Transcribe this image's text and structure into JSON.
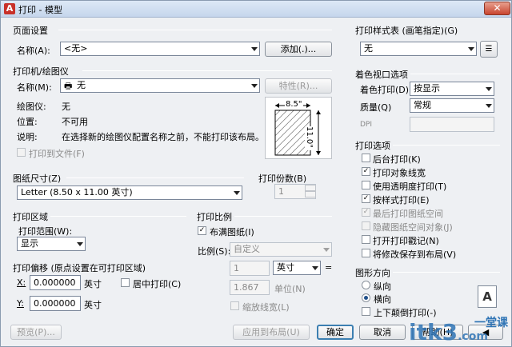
{
  "window": {
    "title": "打印 - 模型",
    "app_icon": "A",
    "close": "✕"
  },
  "page_setup": {
    "group": "页面设置",
    "name_label": "名称(A):",
    "name_value": "<无>",
    "add_button": "添加(.)..."
  },
  "printer": {
    "group": "打印机/绘图仪",
    "name_label": "名称(M):",
    "name_value": "无",
    "properties_button": "特性(R)...",
    "plotter_label": "绘图仪:",
    "plotter_value": "无",
    "location_label": "位置:",
    "location_value": "不可用",
    "description_label": "说明:",
    "description_value": "在选择新的绘图仪配置名称之前，不能打印该布局。",
    "print_to_file": "打印到文件(F)"
  },
  "paper_preview": {
    "width": "8.5\"",
    "height": "11.0\""
  },
  "paper_size": {
    "group": "图纸尺寸(Z)",
    "value": "Letter (8.50 x 11.00 英寸)"
  },
  "copies": {
    "label": "打印份数(B)",
    "value": "1"
  },
  "plot_area": {
    "group": "打印区域",
    "range_label": "打印范围(W):",
    "range_value": "显示"
  },
  "plot_scale": {
    "group": "打印比例",
    "fit_paper": "布满图纸(I)",
    "scale_label": "比例(S):",
    "scale_value": "自定义",
    "value1": "1",
    "unit_value": "英寸",
    "eq": "=",
    "value2": "1.867",
    "unit_label": "单位(N)",
    "scale_lineweights": "缩放线宽(L)"
  },
  "plot_offset": {
    "group": "打印偏移 (原点设置在可打印区域)",
    "x_label": "X:",
    "x_value": "0.000000",
    "x_unit": "英寸",
    "y_label": "Y:",
    "y_value": "0.000000",
    "y_unit": "英寸",
    "center": "居中打印(C)"
  },
  "style_table": {
    "group": "打印样式表 (画笔指定)(G)",
    "value": "无"
  },
  "shaded_viewport": {
    "group": "着色视口选项",
    "shade_label": "着色打印(D)",
    "shade_value": "按显示",
    "quality_label": "质量(Q)",
    "quality_value": "常规",
    "dpi_label": "DPI"
  },
  "plot_options": {
    "group": "打印选项",
    "items": [
      {
        "label": "后台打印(K)",
        "checked": false,
        "disabled": false
      },
      {
        "label": "打印对象线宽",
        "checked": true,
        "disabled": false
      },
      {
        "label": "使用透明度打印(T)",
        "checked": false,
        "disabled": false
      },
      {
        "label": "按样式打印(E)",
        "checked": true,
        "disabled": false
      },
      {
        "label": "最后打印图纸空间",
        "checked": true,
        "disabled": true
      },
      {
        "label": "隐藏图纸空间对象(J)",
        "checked": false,
        "disabled": true
      },
      {
        "label": "打开打印戳记(N)",
        "checked": false,
        "disabled": false
      },
      {
        "label": "将修改保存到布局(V)",
        "checked": false,
        "disabled": false
      }
    ]
  },
  "orientation": {
    "group": "图形方向",
    "portrait": "纵向",
    "landscape": "横向",
    "upside_down": "上下颠倒打印(-)",
    "icon_letter": "A"
  },
  "footer": {
    "preview": "预览(P)...",
    "apply": "应用到布局(U)",
    "ok": "确定",
    "cancel": "取消",
    "help": "帮助(H)"
  },
  "watermark": {
    "brand": "itk3",
    "sub": ".com",
    "cn": "一堂课"
  }
}
